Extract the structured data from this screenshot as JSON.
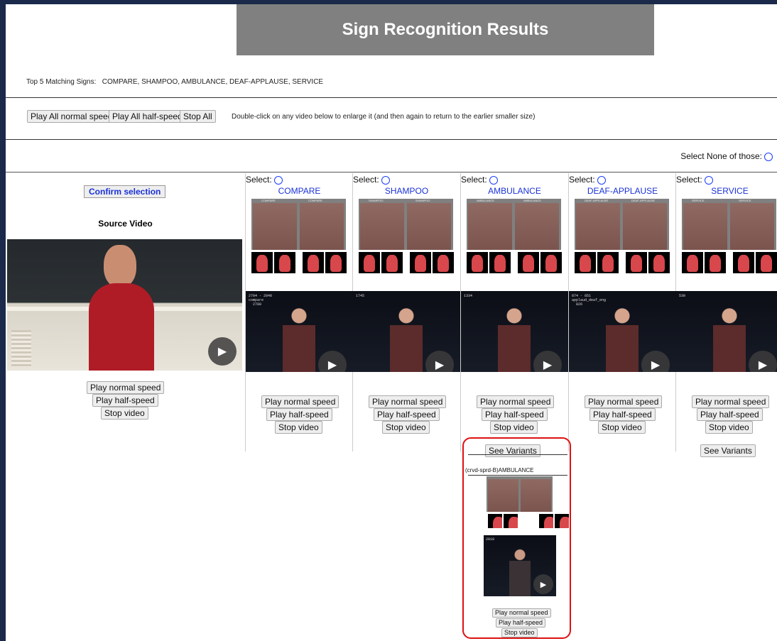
{
  "page": {
    "title": "Sign Recognition Results",
    "top5_label": "Top 5 Matching Signs:",
    "top5_list": "COMPARE,  SHAMPOO,  AMBULANCE,  DEAF-APPLAUSE,  SERVICE",
    "global_buttons": {
      "play_all_normal": "Play All normal speed",
      "play_all_half": "Play All half-speed",
      "stop_all": "Stop All"
    },
    "note": "Double-click on any video below to enlarge it (and then again to return to the earlier smaller size)",
    "select_none_label": "Select None of those:"
  },
  "source": {
    "confirm_label": "Confirm selection",
    "label": "Source Video",
    "play_normal": "Play normal speed",
    "play_half": "Play half-speed",
    "stop": "Stop video"
  },
  "columns": [
    {
      "select_label": "Select:",
      "gloss": "COMPARE",
      "sprite_tags": [
        "COMPARE",
        "COMPARE"
      ],
      "frame_text": "2704 - 2848\ncompare\n  2788",
      "play_normal": "Play normal speed",
      "play_half": "Play half-speed",
      "stop": "Stop video"
    },
    {
      "select_label": "Select:",
      "gloss": "SHAMPOO",
      "sprite_tags": [
        "SHAMPOO",
        "SHAMPOO"
      ],
      "frame_text": "1745",
      "play_normal": "Play normal speed",
      "play_half": "Play half-speed",
      "stop": "Stop video"
    },
    {
      "select_label": "Select:",
      "gloss": "AMBULANCE",
      "sprite_tags": [
        "AMBULANCE",
        "AMBULANCE"
      ],
      "frame_text": "1334",
      "play_normal": "Play normal speed",
      "play_half": "Play half-speed",
      "stop": "Stop video",
      "variants_label": "See Variants"
    },
    {
      "select_label": "Select:",
      "gloss": "DEAF-APPLAUSE",
      "sprite_tags": [
        "DEAF-APPLAUSE",
        "DEAF-APPLAUSE"
      ],
      "frame_text": "874 - 851\napplaud_deaf_eng\n  826",
      "play_normal": "Play normal speed",
      "play_half": "Play half-speed",
      "stop": "Stop video"
    },
    {
      "select_label": "Select:",
      "gloss": "SERVICE",
      "sprite_tags": [
        "SERVICE",
        "SERVICE"
      ],
      "frame_text": "530",
      "play_normal": "Play normal speed",
      "play_half": "Play half-speed",
      "stop": "Stop video",
      "variants_label": "See Variants"
    }
  ],
  "variant": {
    "title": "(crvd-sprd-B)AMBULANCE",
    "frame_text": "2018",
    "play_normal": "Play normal speed",
    "play_half": "Play half-speed",
    "stop": "Stop video"
  },
  "colors": {
    "accent_blue": "#1a32d8",
    "title_bar": "#808080",
    "highlight_red": "#d11111"
  }
}
